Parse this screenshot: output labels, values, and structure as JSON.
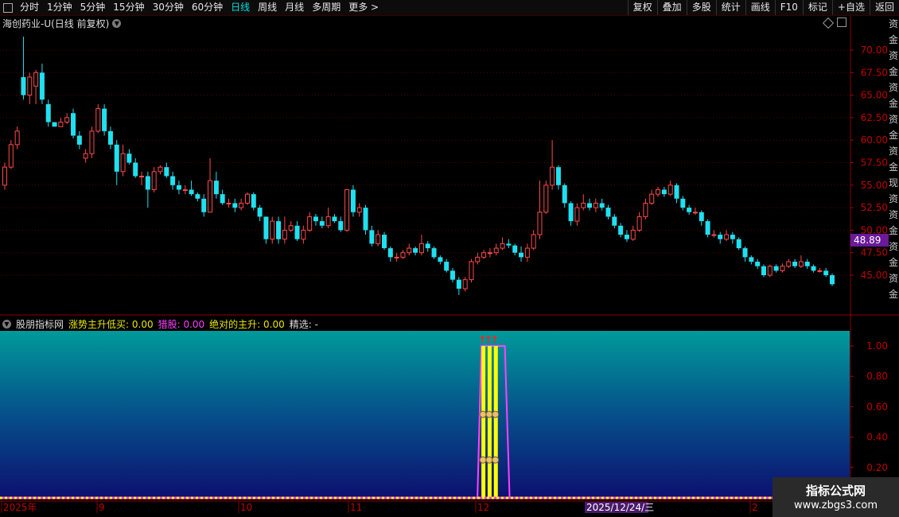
{
  "toolbar": {
    "periods": [
      "分时",
      "1分钟",
      "5分钟",
      "15分钟",
      "30分钟",
      "60分钟",
      "日线",
      "周线",
      "月线",
      "多周期",
      "更多 >"
    ],
    "active": "日线",
    "right_buttons": [
      "复权",
      "叠加",
      "多股",
      "统计",
      "画线",
      "F10",
      "标记",
      "+自选",
      "返回"
    ]
  },
  "main_chart": {
    "title": "海创药业-U(日线 前复权)",
    "price_labels": [
      "70.00",
      "67.50",
      "65.00",
      "62.50",
      "60.00",
      "57.50",
      "55.00",
      "52.50",
      "50.00",
      "47.50",
      "45.00"
    ],
    "current_price": "48.89",
    "current_price_color": "#6a1a9a",
    "up_color": "#ff4a4a",
    "down_color": "#20e0f0"
  },
  "sub_chart": {
    "name": "股朋指标网",
    "labels": [
      {
        "text": "涨势主升低买: 0.00",
        "color": "#e8e800"
      },
      {
        "text": "猎股: 0.00",
        "color": "#ff40ff"
      },
      {
        "text": "绝对的主升: 0.00",
        "color": "#e8e800"
      },
      {
        "text": "精选: -",
        "color": "#dddddd"
      }
    ],
    "y_labels": [
      "1.00",
      "0.80",
      "0.60",
      "0.40",
      "0.20"
    ]
  },
  "x_axis": {
    "labels": [
      "2025年",
      "9",
      "10",
      "11",
      "12",
      "2"
    ],
    "highlight": "2025/12/24/三"
  },
  "side_strip": "资金资金资金资金资金现资资金资金资金",
  "watermark": {
    "line1": "指标公式网",
    "line2": "www.zbgs3.com"
  },
  "chart_data": {
    "type": "candlestick",
    "ylim": [
      43,
      72.5
    ],
    "candles": [
      [
        55,
        57,
        54.5,
        57.5
      ],
      [
        57,
        59.5,
        56.8,
        60
      ],
      [
        59.5,
        61,
        59,
        61.5
      ],
      [
        67,
        65,
        64.5,
        71.5
      ],
      [
        65,
        67,
        64,
        67.5
      ],
      [
        66,
        67.5,
        64,
        67.8
      ],
      [
        67.5,
        64.5,
        64,
        68.5
      ],
      [
        64,
        62,
        61.5,
        64.5
      ],
      [
        62,
        61.5,
        61.5,
        62
      ],
      [
        61.5,
        62,
        61.5,
        62.5
      ],
      [
        62,
        62.5,
        61.8,
        63
      ],
      [
        63,
        60.5,
        60.2,
        63.5
      ],
      [
        60.5,
        59.5,
        59,
        61
      ],
      [
        58,
        58.5,
        57.5,
        59
      ],
      [
        58.5,
        61,
        58,
        61.5
      ],
      [
        61,
        63.5,
        60.8,
        64
      ],
      [
        63.5,
        61,
        60.5,
        64
      ],
      [
        61,
        59.5,
        59,
        61.5
      ],
      [
        59.5,
        56.5,
        55,
        60
      ],
      [
        56.5,
        58.5,
        56,
        59.5
      ],
      [
        58.5,
        57.5,
        57.3,
        59
      ],
      [
        57.5,
        56,
        55.8,
        58
      ],
      [
        56,
        56,
        55,
        56.5
      ],
      [
        56,
        54.5,
        52.5,
        56.5
      ],
      [
        54.5,
        56.5,
        54.2,
        57
      ],
      [
        56.5,
        57,
        56.2,
        57.2
      ],
      [
        57,
        56,
        55.8,
        57.5
      ],
      [
        56,
        55,
        54.5,
        56.5
      ],
      [
        55,
        54.5,
        54,
        55.5
      ],
      [
        54.5,
        54.5,
        54,
        55
      ],
      [
        54.5,
        54,
        53.8,
        55.5
      ],
      [
        54,
        53.5,
        53.2,
        54.2
      ],
      [
        53.5,
        52,
        51.5,
        54
      ],
      [
        52,
        55.5,
        52,
        58
      ],
      [
        55.5,
        54,
        53.5,
        56.5
      ],
      [
        54,
        53,
        52.8,
        54.5
      ],
      [
        53,
        53,
        52.5,
        53.5
      ],
      [
        53,
        52.5,
        52,
        53.5
      ],
      [
        52.5,
        53,
        52.2,
        53.5
      ],
      [
        53,
        54,
        52.8,
        54.2
      ],
      [
        54,
        52.5,
        52.2,
        54.2
      ],
      [
        52.5,
        51.5,
        51,
        52.8
      ],
      [
        51.5,
        49,
        48.5,
        51.5
      ],
      [
        49,
        51,
        48.5,
        51.5
      ],
      [
        51,
        49,
        48.5,
        51.5
      ],
      [
        49,
        50,
        48.5,
        51.5
      ],
      [
        50,
        50.5,
        49.8,
        51
      ],
      [
        50.5,
        49,
        48.8,
        51
      ],
      [
        49,
        50,
        48.5,
        50.5
      ],
      [
        50,
        51.5,
        49.8,
        52
      ],
      [
        51.5,
        51,
        50.5,
        51.8
      ],
      [
        51,
        50.5,
        50.2,
        51.5
      ],
      [
        50.5,
        51.5,
        50.2,
        52.5
      ],
      [
        51.5,
        51,
        50.8,
        51.8
      ],
      [
        51,
        50,
        49.8,
        51.5
      ],
      [
        50,
        54.5,
        49.8,
        54.5
      ],
      [
        54.5,
        52,
        51.5,
        55
      ],
      [
        52,
        52.5,
        51.5,
        53
      ],
      [
        52.5,
        50,
        49.5,
        52.8
      ],
      [
        50,
        48.5,
        48.2,
        50.5
      ],
      [
        48.5,
        49.5,
        48.2,
        50
      ],
      [
        49.5,
        48,
        47.8,
        49.8
      ],
      [
        48,
        47,
        46.5,
        48.2
      ],
      [
        47,
        47,
        46.5,
        47.5
      ],
      [
        47,
        47.5,
        46.8,
        47.8
      ],
      [
        47.5,
        48,
        47.2,
        48.5
      ],
      [
        48,
        47.5,
        47.2,
        48.2
      ],
      [
        47.5,
        48.5,
        47.2,
        49.5
      ],
      [
        48.5,
        48,
        47.6,
        48.8
      ],
      [
        48,
        47,
        46.8,
        48.2
      ],
      [
        47,
        46.5,
        46.2,
        47.2
      ],
      [
        46.5,
        45.5,
        45.3,
        46.8
      ],
      [
        45.5,
        44.5,
        44.2,
        45.8
      ],
      [
        44.5,
        43.5,
        42.8,
        44.8
      ],
      [
        43.5,
        44.5,
        43.2,
        44.8
      ],
      [
        44.5,
        46.5,
        44.2,
        46.8
      ],
      [
        46.5,
        47,
        46.2,
        47.5
      ],
      [
        47,
        47.5,
        46.8,
        47.8
      ],
      [
        47.5,
        47.5,
        47,
        48
      ],
      [
        47.5,
        48,
        47.2,
        48.5
      ],
      [
        48,
        48.5,
        47.8,
        49.2
      ],
      [
        48.5,
        48.3,
        48,
        49
      ],
      [
        48.3,
        47.5,
        47.2,
        48.5
      ],
      [
        47.5,
        47,
        46.5,
        48.2
      ],
      [
        47,
        48,
        46.5,
        48.5
      ],
      [
        48,
        49.5,
        47.8,
        50
      ],
      [
        49.5,
        52,
        49,
        55.5
      ],
      [
        52,
        55,
        51.8,
        55.5
      ],
      [
        55,
        57,
        54.5,
        60
      ],
      [
        57,
        55,
        54.5,
        57.2
      ],
      [
        55,
        53,
        52.5,
        55.2
      ],
      [
        53,
        51,
        50.5,
        53.2
      ],
      [
        51,
        52.5,
        50.5,
        53
      ],
      [
        52.5,
        53,
        52.2,
        54
      ],
      [
        53,
        52.5,
        52.2,
        53.5
      ],
      [
        52.5,
        53,
        52,
        53.5
      ],
      [
        53,
        52.5,
        52.2,
        53.5
      ],
      [
        52.5,
        51.5,
        51.2,
        52.8
      ],
      [
        51.5,
        50.5,
        50.2,
        51.8
      ],
      [
        50.5,
        49.5,
        49.2,
        50.8
      ],
      [
        49.5,
        49,
        48.7,
        50
      ],
      [
        49,
        50,
        48.8,
        50.5
      ],
      [
        50,
        51.5,
        49.8,
        52
      ],
      [
        51.5,
        53,
        51.2,
        53.5
      ],
      [
        53,
        54,
        52.8,
        54.5
      ],
      [
        54,
        54.5,
        53.7,
        54.8
      ],
      [
        54.5,
        54,
        53.7,
        54.8
      ],
      [
        54,
        55,
        53.8,
        55.5
      ],
      [
        55,
        53.5,
        53,
        55.2
      ],
      [
        53.5,
        52.5,
        52.2,
        53.8
      ],
      [
        52.5,
        52,
        51.7,
        52.8
      ],
      [
        52,
        52,
        51.7,
        52.5
      ],
      [
        52,
        51,
        50.5,
        52.2
      ],
      [
        51,
        49.5,
        49.2,
        51.2
      ],
      [
        49.5,
        49.5,
        49.2,
        50
      ],
      [
        49.5,
        49,
        48.5,
        49.8
      ],
      [
        49,
        49.5,
        48.8,
        50
      ],
      [
        49.5,
        49,
        48.5,
        49.8
      ],
      [
        49,
        48,
        47.8,
        49.2
      ],
      [
        48,
        47,
        46.5,
        48.2
      ],
      [
        47,
        46.5,
        46.2,
        47.2
      ],
      [
        46.5,
        46,
        45.7,
        46.8
      ],
      [
        46,
        45,
        44.8,
        46.2
      ],
      [
        45,
        46,
        44.8,
        46.2
      ],
      [
        46,
        45.5,
        45.3,
        46.2
      ],
      [
        45.5,
        46,
        45.3,
        46.3
      ],
      [
        46,
        46.5,
        45.8,
        46.8
      ],
      [
        46.5,
        46,
        45.8,
        46.8
      ],
      [
        46,
        46.5,
        45.8,
        47.2
      ],
      [
        46.5,
        46,
        45.7,
        46.8
      ],
      [
        46,
        45.5,
        45.3,
        46.2
      ],
      [
        45.5,
        45.5,
        45.3,
        45.8
      ],
      [
        45.5,
        45,
        44.8,
        45.8
      ],
      [
        45,
        44,
        43.8,
        45.2
      ]
    ],
    "signal": {
      "start": 77,
      "end": 80,
      "ylim": [
        0,
        1.1
      ]
    }
  }
}
